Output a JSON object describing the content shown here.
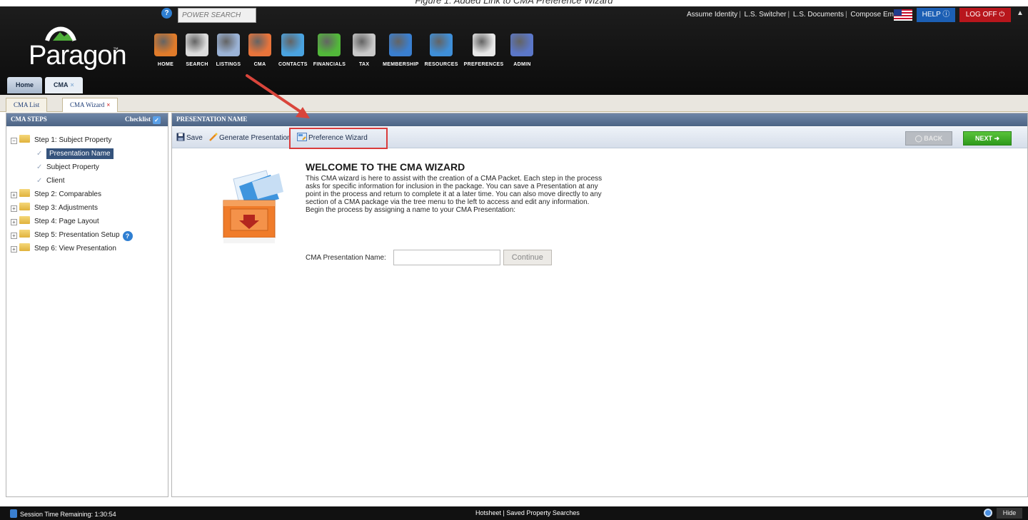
{
  "caption": "Figure 1: Added Link to CMA Preference Wizard",
  "header": {
    "power_search_placeholder": "POWER SEARCH",
    "top_links": [
      "Assume Identity",
      "L.S. Switcher",
      "L.S. Documents",
      "Compose Email"
    ],
    "help_label": "HELP",
    "logoff_label": "LOG OFF",
    "logo_text": "Paragon",
    "logo_tm": "™",
    "nav": [
      {
        "label": "HOME",
        "icon": "home-icon",
        "color": "#e07b2a"
      },
      {
        "label": "SEARCH",
        "icon": "search-icon",
        "color": "#dcdcdc"
      },
      {
        "label": "LISTINGS",
        "icon": "listings-icon",
        "color": "#9bb3d6"
      },
      {
        "label": "CMA",
        "icon": "cma-icon",
        "color": "#e8743b"
      },
      {
        "label": "CONTACTS",
        "icon": "contacts-icon",
        "color": "#4aa3e0"
      },
      {
        "label": "FINANCIALS",
        "icon": "financials-icon",
        "color": "#52b83a"
      },
      {
        "label": "TAX",
        "icon": "tax-icon",
        "color": "#c9c9c9"
      },
      {
        "label": "MEMBERSHIP",
        "icon": "membership-icon",
        "color": "#3a7fd0"
      },
      {
        "label": "RESOURCES",
        "icon": "resources-icon",
        "color": "#3f8fd8"
      },
      {
        "label": "PREFERENCES",
        "icon": "preferences-icon",
        "color": "#e8e8e8"
      },
      {
        "label": "ADMIN",
        "icon": "admin-icon",
        "color": "#5b77c8"
      }
    ],
    "main_tabs": {
      "home": "Home",
      "cma": "CMA",
      "close": "×"
    }
  },
  "subtabs": {
    "list": "CMA List",
    "wizard": "CMA Wizard",
    "close": "×"
  },
  "left": {
    "title": "CMA STEPS",
    "checklist": "Checklist",
    "steps": [
      {
        "label": "Step 1: Subject Property",
        "expanded": true
      },
      {
        "label": "Step 2: Comparables"
      },
      {
        "label": "Step 3: Adjustments"
      },
      {
        "label": "Step 4: Page Layout"
      },
      {
        "label": "Step 5: Presentation Setup"
      },
      {
        "label": "Step 6: View Presentation"
      }
    ],
    "substeps": [
      "Presentation Name",
      "Subject Property",
      "Client"
    ]
  },
  "right": {
    "title": "PRESENTATION NAME",
    "toolbar": {
      "save": "Save",
      "generate": "Generate Presentation",
      "preference": "Preference Wizard",
      "back": "BACK",
      "next": "NEXT"
    },
    "welcome_title": "WELCOME TO THE CMA WIZARD",
    "welcome_lines": [
      "This CMA wizard is here to assist with the creation of a CMA Packet. Each step in the process",
      "asks for specific information for inclusion in the package. You can save a Presentation at any",
      "point in the process and return to complete it at a later time. You can also move directly to any",
      "section of a CMA package via the tree menu to the left to access and edit any information.",
      "Begin the process by assigning a name to your CMA Presentation:"
    ],
    "name_label": "CMA Presentation Name:",
    "name_value": "",
    "continue_label": "Continue"
  },
  "footer": {
    "session": "Session Time Remaining: 1:30:54",
    "links": "Hotsheet  |  Saved Property Searches",
    "hide": "Hide"
  }
}
